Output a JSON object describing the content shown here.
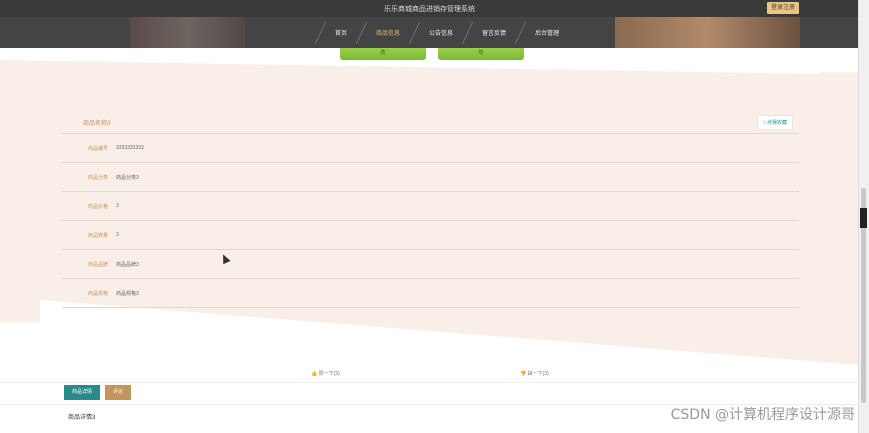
{
  "header": {
    "title": "乐乐商城商品进销存管理系统",
    "login_label": "登录注册"
  },
  "nav": {
    "items": [
      {
        "label": "首页",
        "active": false
      },
      {
        "label": "商品信息",
        "active": true
      },
      {
        "label": "公告信息",
        "active": false
      },
      {
        "label": "留言反馈",
        "active": false
      },
      {
        "label": "后台管理",
        "active": false
      }
    ]
  },
  "product_images": [
    {
      "label": "叻"
    },
    {
      "label": "叻"
    }
  ],
  "detail": {
    "title": "商品名称3",
    "favorite_label": "☆点我收藏",
    "fields": [
      {
        "label": "商品编号",
        "value": "3333333333"
      },
      {
        "label": "商品分类",
        "value": "商品分类3"
      },
      {
        "label": "商品价格",
        "value": "3"
      },
      {
        "label": "商品数量",
        "value": "3"
      },
      {
        "label": "商品品牌",
        "value": "商品品牌3"
      },
      {
        "label": "商品规格",
        "value": "商品规格3"
      }
    ]
  },
  "votes": {
    "up_label": "赞一下(3)",
    "down_label": "踩一下(3)"
  },
  "tabs": {
    "detail_label": "商品详情",
    "comment_label": "评论"
  },
  "content": {
    "detail_text": "商品详情3"
  },
  "watermark": "CSDN @计算机程序设计源哥",
  "colors": {
    "accent_teal": "#2a8a8a",
    "accent_gold": "#c4955a",
    "panel_bg": "#f9efe8"
  }
}
